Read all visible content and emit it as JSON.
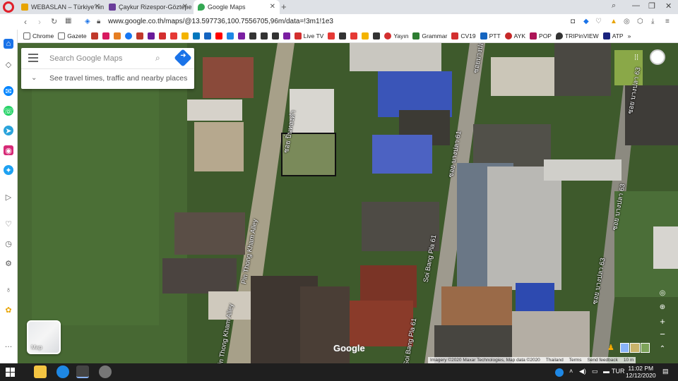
{
  "tabs": [
    {
      "title": "WEBASLAN – Türkiye'nin e",
      "color": "#f5c518"
    },
    {
      "title": "Çaykur Rizespor-Göztepe",
      "color": "#6a3d9a"
    },
    {
      "title": "Google Maps",
      "color": "#34a853"
    }
  ],
  "address_bar": {
    "url": "www.google.co.th/maps/@13.597736,100.7556705,96m/data=!3m1!1e3"
  },
  "bookmarks": [
    "Chrome",
    "Gazete",
    "Live TV",
    "Yayın",
    "Grammar",
    "CV19",
    "PTT",
    "AYK",
    "POP",
    "TRIPinVIEW",
    "ATP"
  ],
  "search": {
    "placeholder": "Search Google Maps",
    "travel_text": "See travel times, traffic and nearby places"
  },
  "map_labels": {
    "alley_thai": "ซอย ปิ่นทองคำ",
    "alley_en_1": "Pin Thong Kham Alley",
    "alley_en_2": "Pin Thong Kham Alley",
    "soi61_thai": "ซอย บางปลา 61",
    "soi61_en_1": "Soi Bang Pla 61",
    "soi61_en_2": "Soi Bang Pla 61",
    "soi63_thai_1": "ซอย บางปลา 63",
    "soi63_thai_2": "ซอย บางปลา 63",
    "soi63_thai_3": "ซอย บางปลา 63",
    "top_thai": "ซอยบางปลา"
  },
  "layer_button": {
    "label": "Map"
  },
  "logo": "Google",
  "attribution": [
    "Imagery ©2020 Maxar Technologies, Map data ©2020",
    "Thailand",
    "Terms",
    "Send feedback",
    "10 m"
  ],
  "taskbar": {
    "time": "11:02 PM",
    "date": "12/12/2020",
    "lang": "TUR"
  }
}
